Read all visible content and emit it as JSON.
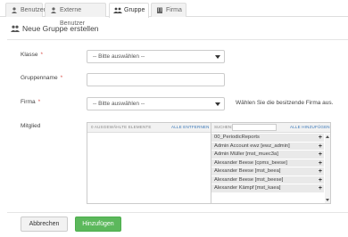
{
  "tabs": [
    {
      "label": "Benutzer",
      "icon": "user-icon",
      "active": false
    },
    {
      "label": "Externe Benutzer",
      "icon": "user-icon",
      "active": false
    },
    {
      "label": "Gruppe",
      "icon": "users-icon",
      "active": true
    },
    {
      "label": "Firma",
      "icon": "building-icon",
      "active": false
    }
  ],
  "panel": {
    "title": "Neue Gruppe erstellen",
    "icon": "users-icon"
  },
  "form": {
    "klasse": {
      "label": "Klasse",
      "required": "*",
      "value": "-- Bitte auswählen --"
    },
    "gruppenname": {
      "label": "Gruppenname",
      "required": "*",
      "value": ""
    },
    "firma": {
      "label": "Firma",
      "required": "*",
      "value": "-- Bitte auswählen --",
      "hint": "Wählen Sie die besitzende Firma aus."
    },
    "mitglied": {
      "label": "Mitglied"
    }
  },
  "multiselect": {
    "selected_count": "0 AUSGEWÄHLTE ELEMENTE",
    "remove_all": "ALLE ENTFERNEN",
    "search_label": "SUCHEN:",
    "search_value": "",
    "add_all": "ALLE HINZUFÜGEN",
    "add_symbol": "+",
    "available": [
      "00_PeriodicReports",
      "Admin Account ewz [ewz_admin]",
      "Admin Müller [mst_muec3a]",
      "Alexander Beese [cpms_beese]",
      "Alexander Beese [mst_beea]",
      "Alexander Beese [mst_beese]",
      "Alexander Kämpf [mst_kaea]"
    ]
  },
  "buttons": {
    "cancel": "Abbrechen",
    "submit": "Hinzufügen"
  },
  "colors": {
    "accent_green": "#5cb85c",
    "link_blue": "#3a78b8",
    "required_red": "#d9534f"
  }
}
